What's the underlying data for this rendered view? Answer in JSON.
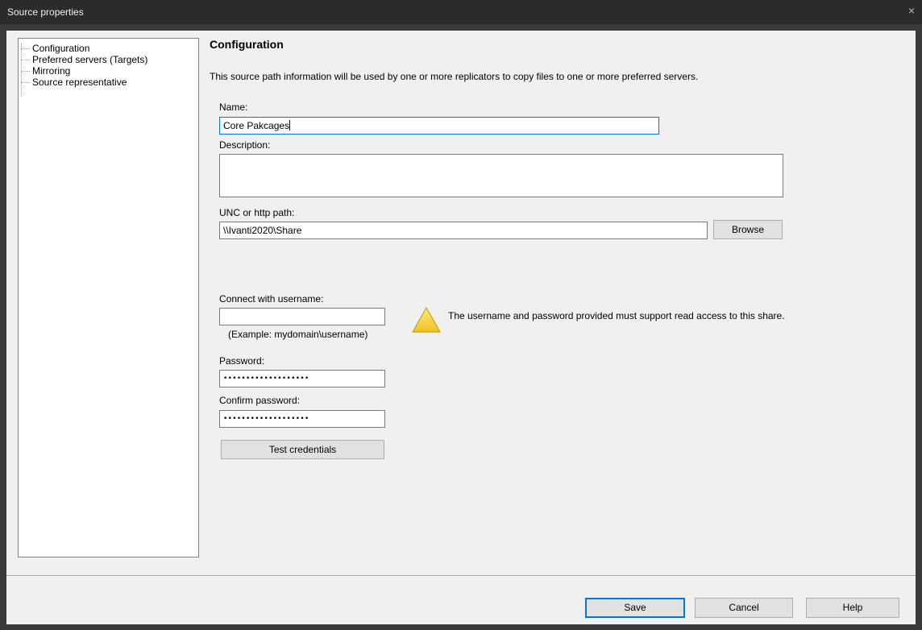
{
  "window": {
    "title": "Source properties",
    "close_glyph": "×"
  },
  "tree": {
    "items": [
      {
        "label": "Configuration",
        "selected": true
      },
      {
        "label": "Preferred servers (Targets)"
      },
      {
        "label": "Mirroring"
      },
      {
        "label": "Source representative"
      }
    ]
  },
  "content": {
    "heading": "Configuration",
    "info": "This source path information will be used by one or more replicators to copy files to one or more preferred servers.",
    "name": {
      "label": "Name:",
      "value": "Core Pakcages"
    },
    "description": {
      "label": "Description:",
      "value": ""
    },
    "path": {
      "label": "UNC or http path:",
      "value": "\\\\Ivanti2020\\Share",
      "browse_label": "Browse"
    },
    "username": {
      "label": "Connect  with username:",
      "value": "",
      "example": "(Example: mydomain\\username)"
    },
    "warning": {
      "icon": "warning-icon",
      "text": "The username and password provided must support read access to this share."
    },
    "password": {
      "label": "Password:",
      "masked": "•••••••••••••••••••"
    },
    "confirm_password": {
      "label": "Confirm password:",
      "masked": "•••••••••••••••••••"
    },
    "test_credentials_label": "Test credentials"
  },
  "footer": {
    "save_label": "Save",
    "cancel_label": "Cancel",
    "help_label": "Help"
  },
  "colors": {
    "accent": "#0078d7",
    "warning_fill": "#f7d13c"
  }
}
